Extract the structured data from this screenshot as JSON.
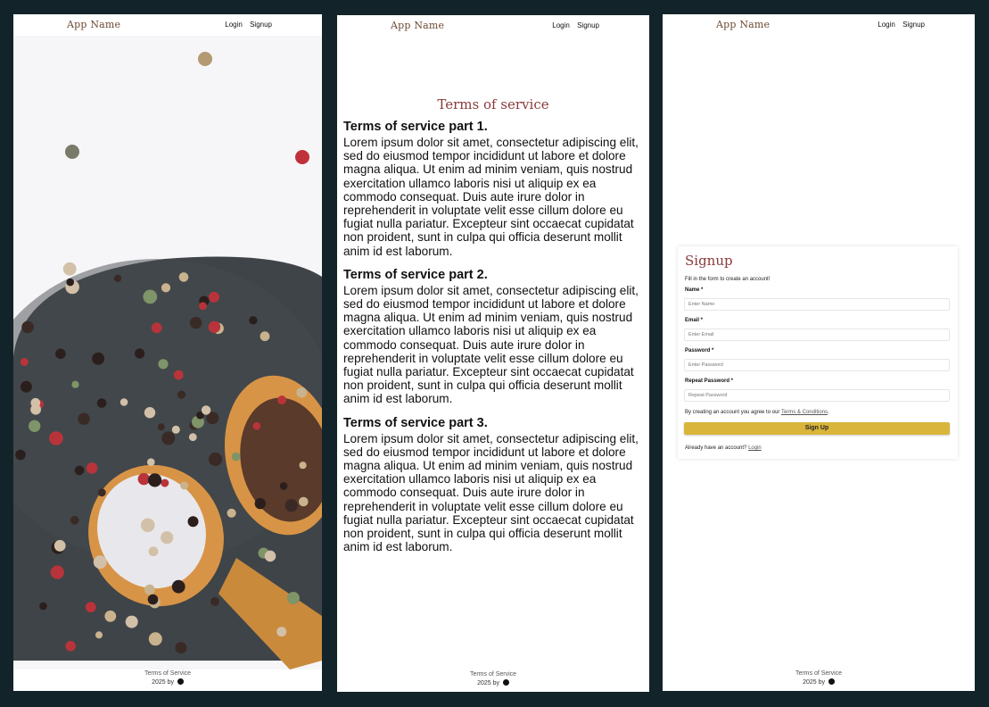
{
  "app": {
    "brand": "App Name",
    "login": "Login",
    "signup": "Signup"
  },
  "footer": {
    "tos": "Terms of Service",
    "copyright": "2025 by"
  },
  "terms": {
    "title": "Terms of service",
    "sections": [
      {
        "heading": "Terms of service part 1.",
        "body": "Lorem ipsum dolor sit amet, consectetur adipiscing elit, sed do eiusmod tempor incididunt ut labore et dolore magna aliqua. Ut enim ad minim veniam, quis nostrud exercitation ullamco laboris nisi ut aliquip ex ea commodo consequat. Duis aute irure dolor in reprehenderit in voluptate velit esse cillum dolore eu fugiat nulla pariatur. Excepteur sint occaecat cupidatat non proident, sunt in culpa qui officia deserunt mollit anim id est laborum."
      },
      {
        "heading": "Terms of service part 2.",
        "body": "Lorem ipsum dolor sit amet, consectetur adipiscing elit, sed do eiusmod tempor incididunt ut labore et dolore magna aliqua. Ut enim ad minim veniam, quis nostrud exercitation ullamco laboris nisi ut aliquip ex ea commodo consequat. Duis aute irure dolor in reprehenderit in voluptate velit esse cillum dolore eu fugiat nulla pariatur. Excepteur sint occaecat cupidatat non proident, sunt in culpa qui officia deserunt mollit anim id est laborum."
      },
      {
        "heading": "Terms of service part 3.",
        "body": "Lorem ipsum dolor sit amet, consectetur adipiscing elit, sed do eiusmod tempor incididunt ut labore et dolore magna aliqua. Ut enim ad minim veniam, quis nostrud exercitation ullamco laboris nisi ut aliquip ex ea commodo consequat. Duis aute irure dolor in reprehenderit in voluptate velit esse cillum dolore eu fugiat nulla pariatur. Excepteur sint occaecat cupidatat non proident, sunt in culpa qui officia deserunt mollit anim id est laborum."
      }
    ]
  },
  "signup": {
    "title": "Signup",
    "subtitle": "Fill in the form to create an account!",
    "name_label": "Name *",
    "name_placeholder": "Enter Name",
    "email_label": "Email *",
    "email_placeholder": "Enter Email",
    "password_label": "Password *",
    "password_placeholder": "Enter Password",
    "repeat_label": "Repeat Password *",
    "repeat_placeholder": "Repeat Password",
    "terms_prefix": "By creating an account you agree to our ",
    "terms_link": "Terms & Conditions",
    "terms_suffix": ".",
    "button": "Sign Up",
    "login_prefix": "Already have an account? ",
    "login_link": "Login"
  },
  "colors": {
    "background": "#13232a",
    "accent": "#d9b53b",
    "heading": "#8a3a3a",
    "brand": "#6b4a32"
  },
  "icons": {
    "footer": "github-icon"
  }
}
